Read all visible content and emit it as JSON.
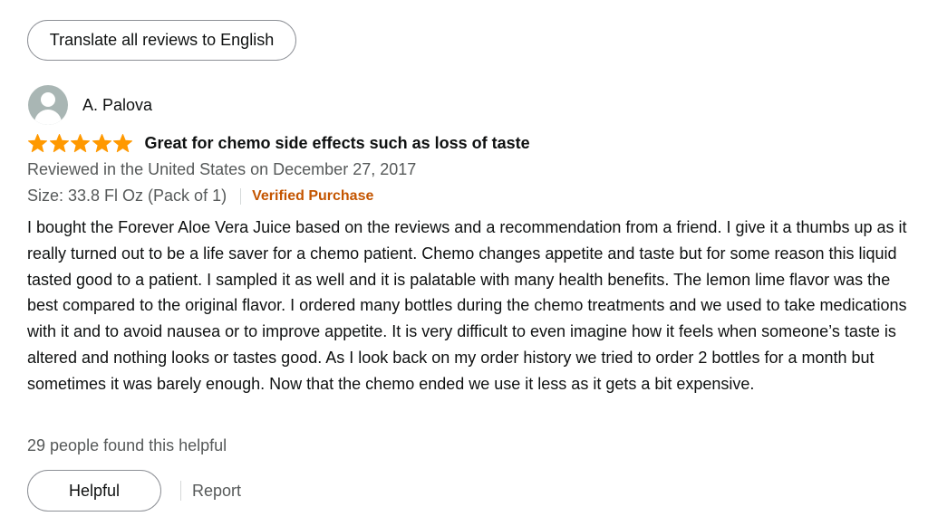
{
  "translate_button": {
    "label": "Translate all reviews to English"
  },
  "review": {
    "author": "A. Palova",
    "rating": 5,
    "rating_max": 5,
    "star_color": "#ff9900",
    "title": "Great for chemo side effects such as loss of taste",
    "date_text": "Reviewed in the United States on December 27, 2017",
    "size_text": "Size: 33.8 Fl Oz (Pack of 1)",
    "verified_label": "Verified Purchase",
    "verified_color": "#c45500",
    "body": "I bought the Forever Aloe Vera Juice based on the reviews and a recommendation from a friend. I give it a thumbs up as it really turned out to be a life saver for a chemo patient. Chemo changes appetite and taste but for some reason this liquid tasted good to a patient. I sampled it as well and it is palatable with many health benefits. The lemon lime flavor was the best compared to the original flavor. I ordered many bottles during the chemo treatments and we used to take medications with it and to avoid nausea or to improve appetite. It is very difficult to even imagine how it feels when someone’s taste is altered and nothing looks or tastes good. As I look back on my order history we tried to order 2 bottles for a month but sometimes it was barely enough. Now that the chemo ended we use it less as it gets a bit expensive.",
    "helpful_count_text": "29 people found this helpful"
  },
  "actions": {
    "helpful_label": "Helpful",
    "report_label": "Report"
  },
  "icons": {
    "avatar": "default-user-avatar-icon",
    "star": "star-icon"
  }
}
